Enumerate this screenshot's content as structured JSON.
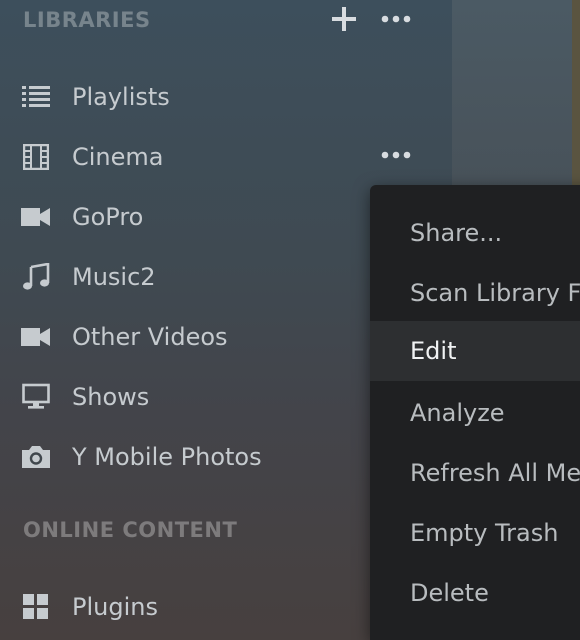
{
  "libraries": {
    "title": "LIBRARIES",
    "actions": [
      {
        "name": "add-library",
        "icon": "plus-icon"
      },
      {
        "name": "libraries-more",
        "icon": "more-horizontal-icon"
      }
    ],
    "items": [
      {
        "label": "Playlists",
        "icon": "list-icon"
      },
      {
        "label": "Cinema",
        "icon": "film-icon"
      },
      {
        "label": "GoPro",
        "icon": "video-camera-icon"
      },
      {
        "label": "Music2",
        "icon": "music-note-icon"
      },
      {
        "label": "Other Videos",
        "icon": "video-camera-icon"
      },
      {
        "label": "Shows",
        "icon": "monitor-icon"
      },
      {
        "label": "Y Mobile Photos",
        "icon": "camera-icon"
      }
    ]
  },
  "online_content": {
    "title": "ONLINE CONTENT",
    "items": [
      {
        "label": "Plugins",
        "icon": "grid-icon"
      }
    ]
  },
  "context_menu": {
    "items": [
      {
        "label": "Share..."
      },
      {
        "label": "Scan Library Files"
      },
      {
        "label": "Edit",
        "active": true
      },
      {
        "label": "Analyze"
      },
      {
        "label": "Refresh All Metadata"
      },
      {
        "label": "Empty Trash"
      },
      {
        "label": "Delete"
      }
    ]
  },
  "colors": {
    "sidebar_text": "#c6cbcf",
    "section_title": "#6a747b",
    "menu_bg": "#1f2022",
    "menu_active_bg": "#2d2f31"
  }
}
